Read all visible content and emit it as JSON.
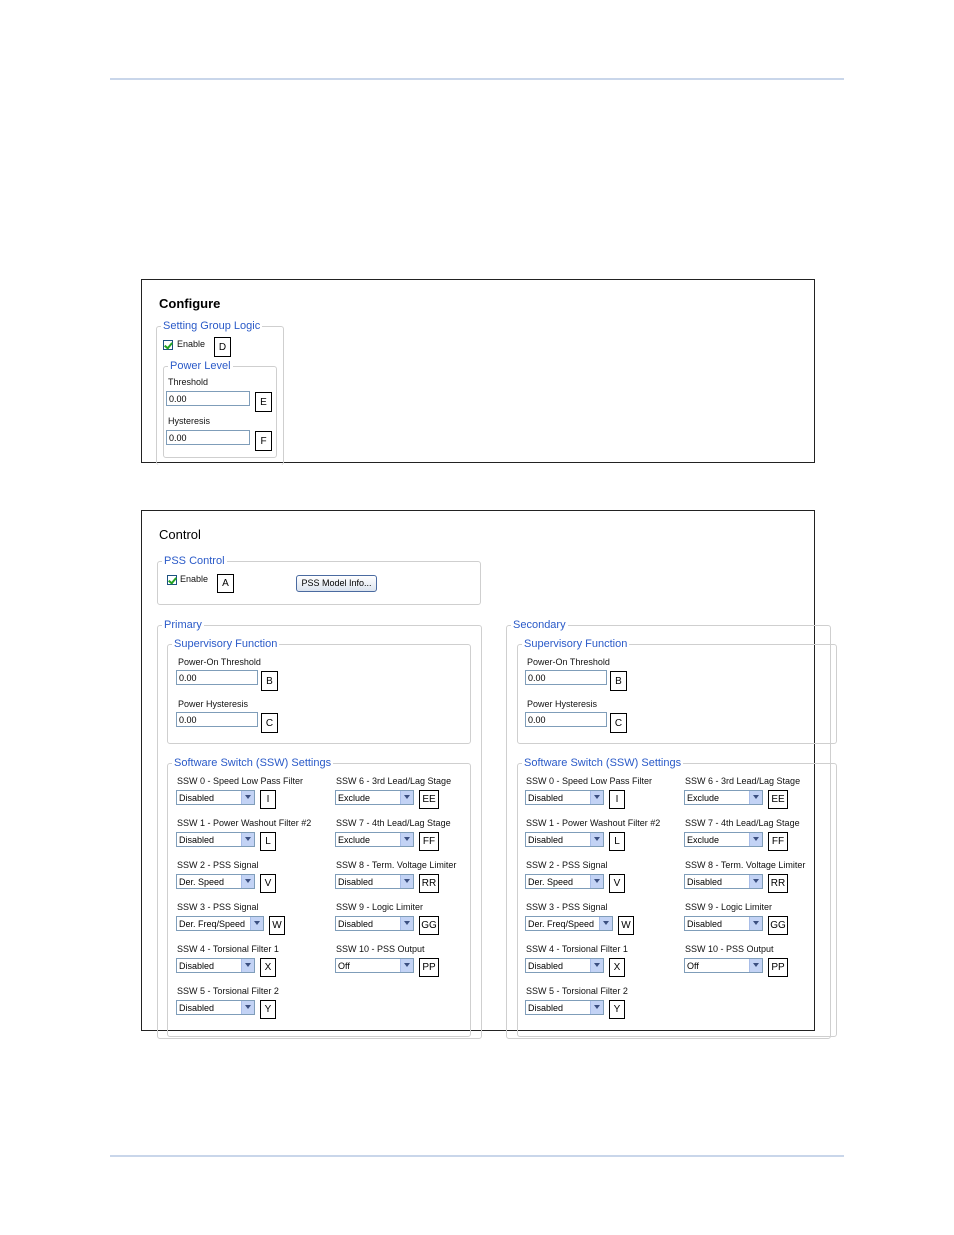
{
  "configure": {
    "title": "Configure",
    "group_title": "Setting Group Logic",
    "enable_label": "Enable",
    "enable_tag": "D",
    "power_level": {
      "title": "Power Level",
      "threshold_label": "Threshold",
      "threshold_value": "0.00",
      "threshold_tag": "E",
      "hysteresis_label": "Hysteresis",
      "hysteresis_value": "0.00",
      "hysteresis_tag": "F"
    }
  },
  "control": {
    "title": "Control",
    "pss_control": {
      "title": "PSS Control",
      "enable_label": "Enable",
      "enable_tag": "A",
      "model_info_button": "PSS Model Info..."
    },
    "primary": {
      "title": "Primary",
      "supervisory_title": "Supervisory Function",
      "power_on_label": "Power-On Threshold",
      "power_on_value": "0.00",
      "power_on_tag": "B",
      "power_hyst_label": "Power Hysteresis",
      "power_hyst_value": "0.00",
      "power_hyst_tag": "C",
      "ssw_title": "Software Switch (SSW) Settings",
      "ssw_left": [
        {
          "label": "SSW 0 - Speed Low Pass Filter",
          "value": "Disabled",
          "tag": "I"
        },
        {
          "label": "SSW 1 - Power Washout Filter #2",
          "value": "Disabled",
          "tag": "L"
        },
        {
          "label": "SSW 2 - PSS Signal",
          "value": "Der. Speed",
          "tag": "V"
        },
        {
          "label": "SSW 3 - PSS Signal",
          "value": "Der. Freq/Speed",
          "tag": "W"
        },
        {
          "label": "SSW 4 - Torsional Filter 1",
          "value": "Disabled",
          "tag": "X"
        },
        {
          "label": "SSW 5 - Torsional Filter 2",
          "value": "Disabled",
          "tag": "Y"
        }
      ],
      "ssw_right": [
        {
          "label": "SSW 6 - 3rd Lead/Lag Stage",
          "value": "Exclude",
          "tag": "EE"
        },
        {
          "label": "SSW 7 - 4th Lead/Lag Stage",
          "value": "Exclude",
          "tag": "FF"
        },
        {
          "label": "SSW 8 - Term. Voltage Limiter",
          "value": "Disabled",
          "tag": "RR"
        },
        {
          "label": "SSW 9 - Logic Limiter",
          "value": "Disabled",
          "tag": "GG"
        },
        {
          "label": "SSW 10 - PSS Output",
          "value": "Off",
          "tag": "PP"
        }
      ]
    },
    "secondary": {
      "title": "Secondary",
      "supervisory_title": "Supervisory Function",
      "power_on_label": "Power-On Threshold",
      "power_on_value": "0.00",
      "power_on_tag": "B",
      "power_hyst_label": "Power Hysteresis",
      "power_hyst_value": "0.00",
      "power_hyst_tag": "C",
      "ssw_title": "Software Switch (SSW) Settings",
      "ssw_left": [
        {
          "label": "SSW 0 - Speed Low Pass Filter",
          "value": "Disabled",
          "tag": "I"
        },
        {
          "label": "SSW 1 - Power Washout Filter #2",
          "value": "Disabled",
          "tag": "L"
        },
        {
          "label": "SSW 2 - PSS Signal",
          "value": "Der. Speed",
          "tag": "V"
        },
        {
          "label": "SSW 3 - PSS Signal",
          "value": "Der. Freq/Speed",
          "tag": "W"
        },
        {
          "label": "SSW 4 - Torsional Filter 1",
          "value": "Disabled",
          "tag": "X"
        },
        {
          "label": "SSW 5 - Torsional Filter 2",
          "value": "Disabled",
          "tag": "Y"
        }
      ],
      "ssw_right": [
        {
          "label": "SSW 6 - 3rd Lead/Lag Stage",
          "value": "Exclude",
          "tag": "EE"
        },
        {
          "label": "SSW 7 - 4th Lead/Lag Stage",
          "value": "Exclude",
          "tag": "FF"
        },
        {
          "label": "SSW 8 - Term. Voltage Limiter",
          "value": "Disabled",
          "tag": "RR"
        },
        {
          "label": "SSW 9 - Logic Limiter",
          "value": "Disabled",
          "tag": "GG"
        },
        {
          "label": "SSW 10 - PSS Output",
          "value": "Off",
          "tag": "PP"
        }
      ]
    }
  }
}
